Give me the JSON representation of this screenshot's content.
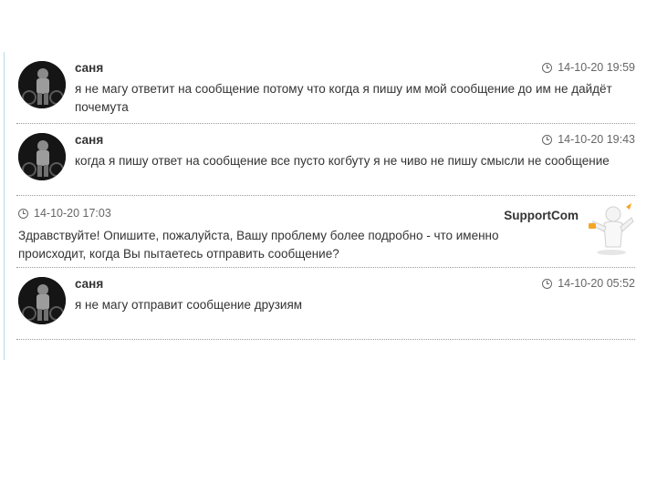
{
  "messages": [
    {
      "author": "саня",
      "timestamp": "14-10-20 19:59",
      "text": "я не магу ответит на сообщение потому что когда я пишу им мой сообщение до им не дайдёт почемута"
    },
    {
      "author": "саня",
      "timestamp": "14-10-20 19:43",
      "text": "когда я пишу ответ на сообщение все пусто когбуту я не чиво не пишу смысли не сообщение"
    },
    {
      "author": "SupportCom",
      "timestamp": "14-10-20 17:03",
      "text": "Здравствуйте! Опишите, пожалуйста, Вашу проблему более подробно - что именно происходит, когда Вы пытаетесь отправить сообщение?"
    },
    {
      "author": "саня",
      "timestamp": "14-10-20 05:52",
      "text": "я не магу отправит сообщение друзиям"
    }
  ],
  "icons": {
    "user_avatar": "user-avatar-photo",
    "support_logo": "support-mascot-logo",
    "time": "clock-icon"
  },
  "colors": {
    "text": "#333333",
    "meta": "#666666",
    "separator": "#9a9a9a",
    "left_rule": "#b9dbea"
  }
}
